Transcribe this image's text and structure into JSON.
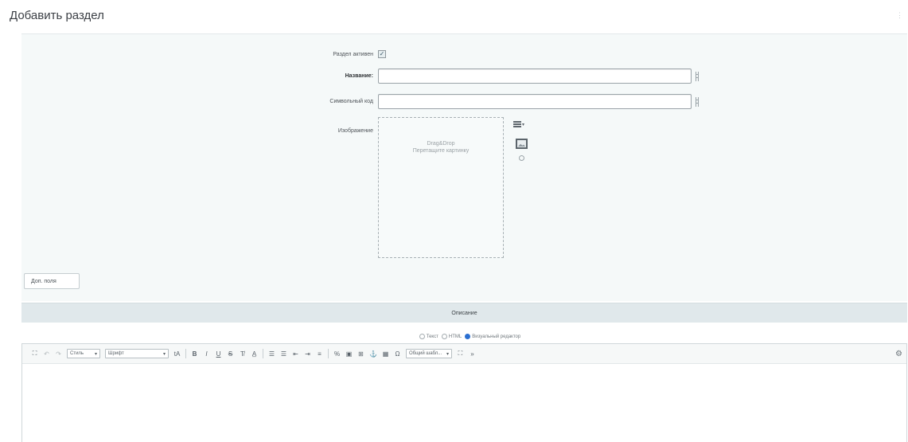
{
  "page": {
    "title": "Добавить раздел"
  },
  "form": {
    "active_label": "Раздел активен",
    "active_checked": true,
    "name_label": "Название:",
    "name_value": "",
    "code_label": "Символьный код",
    "code_value": "",
    "image_label": "Изображение",
    "drop_line1": "Drag&Drop",
    "drop_line2": "Перетащите картинку"
  },
  "buttons": {
    "more_label": "Доп. поля"
  },
  "description": {
    "header": "Описание",
    "modes": [
      {
        "label": "Текст",
        "checked": false
      },
      {
        "label": "HTML",
        "checked": false
      },
      {
        "label": "Визуальный редактор",
        "checked": true
      }
    ]
  },
  "toolbar": {
    "style_select": "Стиль",
    "font_select": "Шрифт",
    "template_select": "Общий шабл..."
  },
  "colors": {
    "accent": "#2b6fd1",
    "form_bg": "#f5f9f9",
    "section_header_bg": "#e0e8eb"
  }
}
